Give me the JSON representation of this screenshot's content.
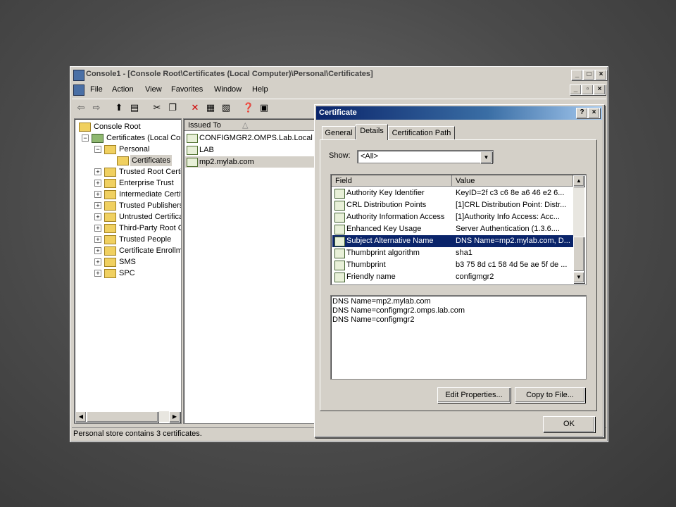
{
  "mmc": {
    "title": "Console1 - [Console Root\\Certificates (Local Computer)\\Personal\\Certificates]",
    "menu": [
      "File",
      "Action",
      "View",
      "Favorites",
      "Window",
      "Help"
    ],
    "tree": [
      {
        "label": "Console Root",
        "level": 0
      },
      {
        "label": "Certificates (Local Com",
        "level": 1,
        "expander": "−"
      },
      {
        "label": "Personal",
        "level": 2,
        "expander": "−"
      },
      {
        "label": "Certificates",
        "level": 3,
        "selected": true
      },
      {
        "label": "Trusted Root Certi",
        "level": 2,
        "expander": "+"
      },
      {
        "label": "Enterprise Trust",
        "level": 2,
        "expander": "+"
      },
      {
        "label": "Intermediate Certif",
        "level": 2,
        "expander": "+"
      },
      {
        "label": "Trusted Publishers",
        "level": 2,
        "expander": "+"
      },
      {
        "label": "Untrusted Certifica",
        "level": 2,
        "expander": "+"
      },
      {
        "label": "Third-Party Root C",
        "level": 2,
        "expander": "+"
      },
      {
        "label": "Trusted People",
        "level": 2,
        "expander": "+"
      },
      {
        "label": "Certificate Enrollme",
        "level": 2,
        "expander": "+"
      },
      {
        "label": "SMS",
        "level": 2,
        "expander": "+"
      },
      {
        "label": "SPC",
        "level": 2,
        "expander": "+"
      }
    ],
    "list_header": "Issued To",
    "list_items": [
      "CONFIGMGR2.OMPS.Lab.Local",
      "LAB",
      "mp2.mylab.com"
    ],
    "status": "Personal store contains 3 certificates."
  },
  "dialog": {
    "title": "Certificate",
    "tabs": [
      "General",
      "Details",
      "Certification Path"
    ],
    "active_tab": "Details",
    "show_label": "Show:",
    "show_value": "<All>",
    "grid_headers": {
      "field": "Field",
      "value": "Value"
    },
    "rows": [
      {
        "field": "Authority Key Identifier",
        "value": "KeyID=2f c3 c6 8e a6 46 e2 6..."
      },
      {
        "field": "CRL Distribution Points",
        "value": "[1]CRL Distribution Point: Distr..."
      },
      {
        "field": "Authority Information Access",
        "value": "[1]Authority Info Access: Acc..."
      },
      {
        "field": "Enhanced Key Usage",
        "value": "Server Authentication (1.3.6...."
      },
      {
        "field": "Subject Alternative Name",
        "value": "DNS Name=mp2.mylab.com, D...",
        "selected": true
      },
      {
        "field": "Thumbprint algorithm",
        "value": "sha1"
      },
      {
        "field": "Thumbprint",
        "value": "b3 75 8d c1 58 4d 5e ae 5f de ..."
      },
      {
        "field": "Friendly name",
        "value": "configmgr2"
      }
    ],
    "detail_lines": [
      "DNS Name=mp2.mylab.com",
      "DNS Name=configmgr2.omps.lab.com",
      "DNS Name=configmgr2"
    ],
    "edit_button": "Edit Properties...",
    "copy_button": "Copy to File...",
    "ok_button": "OK",
    "help_glyph": "?",
    "close_glyph": "×"
  }
}
